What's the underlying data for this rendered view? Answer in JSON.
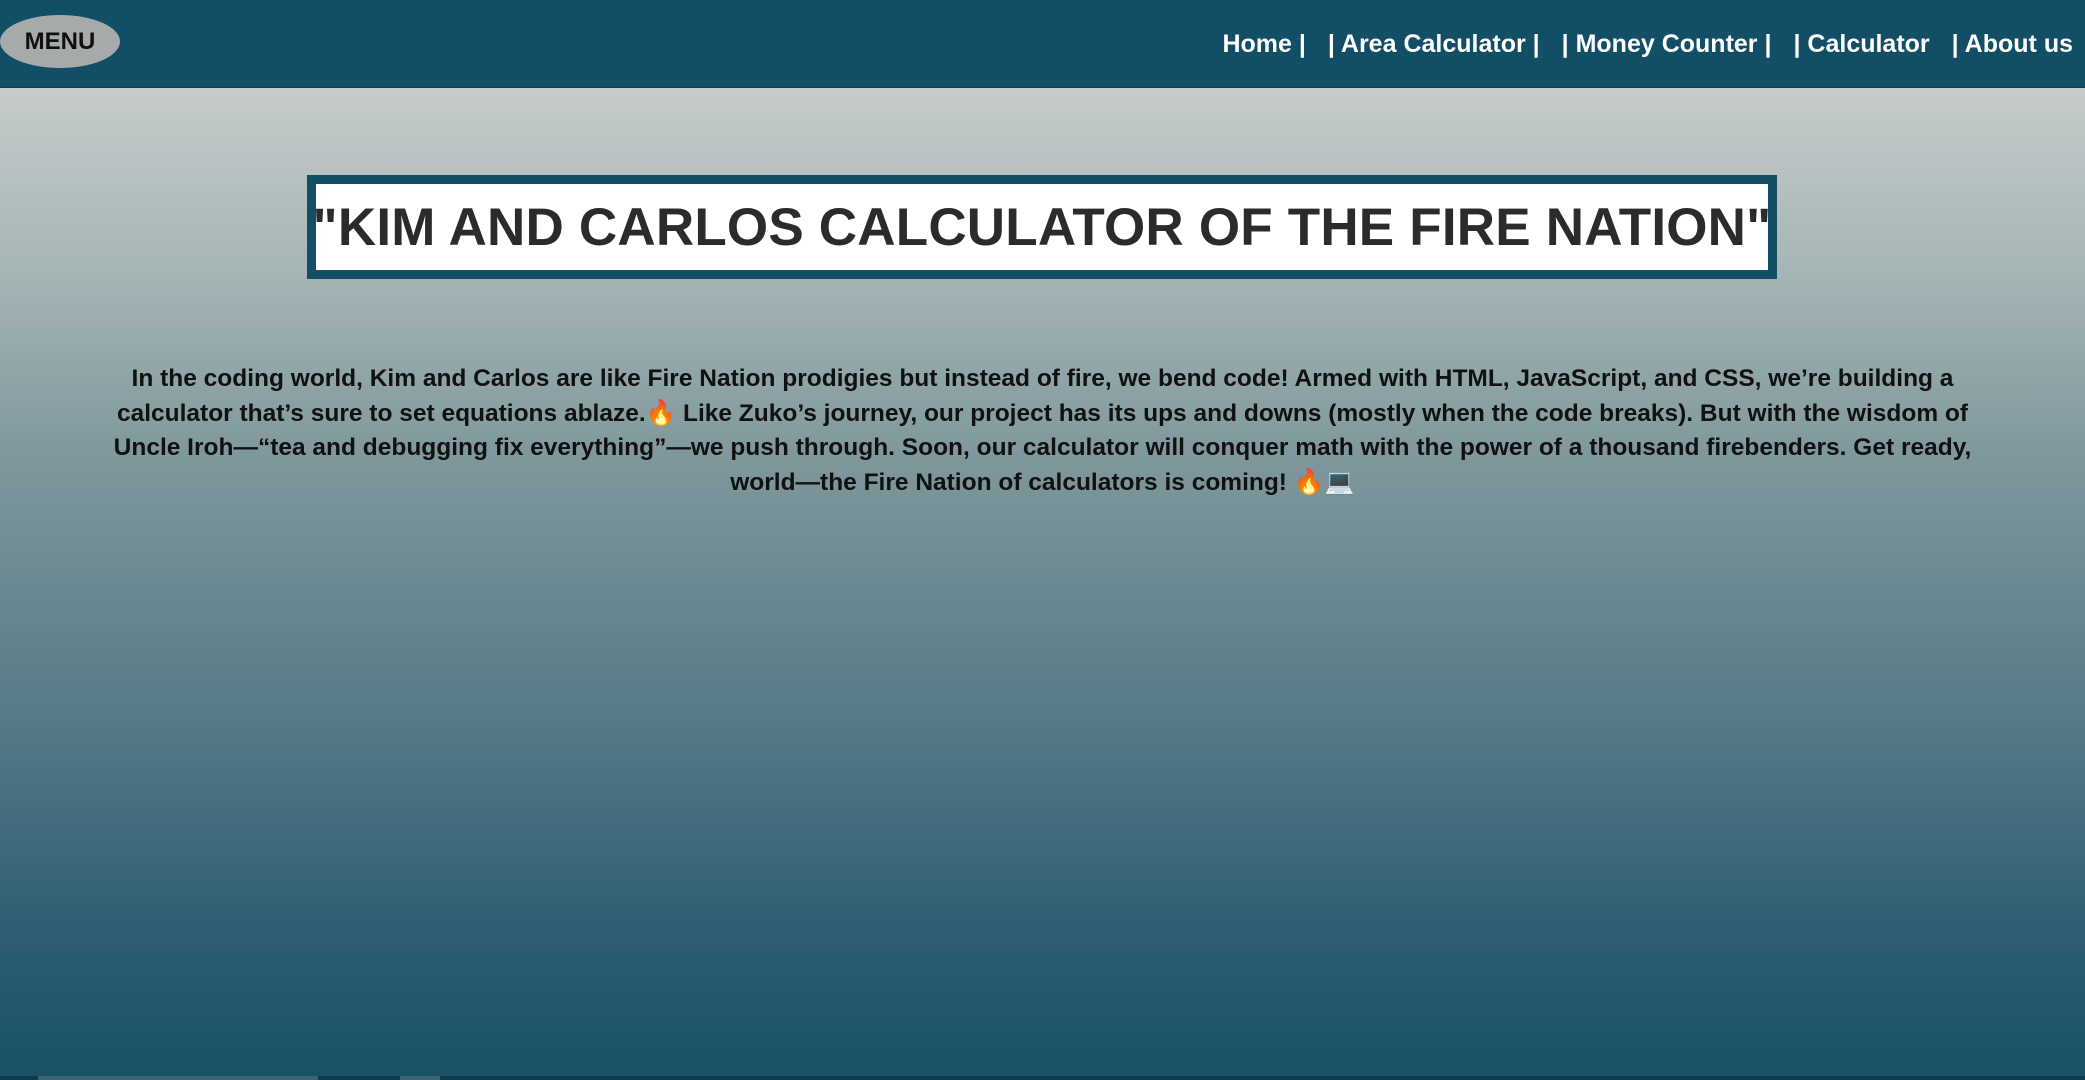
{
  "nav": {
    "menu_label": "MENU",
    "links": [
      {
        "label": "Home |"
      },
      {
        "label": "| Area Calculator |"
      },
      {
        "label": "| Money Counter |"
      },
      {
        "label": "| Calculator"
      },
      {
        "label": "| About us"
      }
    ]
  },
  "main": {
    "title": "\"KIM AND CARLOS CALCULATOR OF THE FIRE NATION\"",
    "intro": "In the coding world, Kim and Carlos are like Fire Nation prodigies but instead of fire, we bend code! Armed with HTML, JavaScript, and CSS, we’re building a calculator that’s sure to set equations ablaze.🔥 Like Zuko’s journey, our project has its ups and downs (mostly when the code breaks). But with the wisdom of Uncle Iroh—“tea and debugging fix everything”—we push through. Soon, our calculator will conquer math with the power of a thousand firebenders. Get ready, world—the Fire Nation of calculators is coming! 🔥💻"
  },
  "colors": {
    "navbar": "#124e66",
    "title_border": "#124e66",
    "menu_button": "#a7aaab",
    "background_top": "#c6cccb",
    "background_bottom": "#185066"
  }
}
